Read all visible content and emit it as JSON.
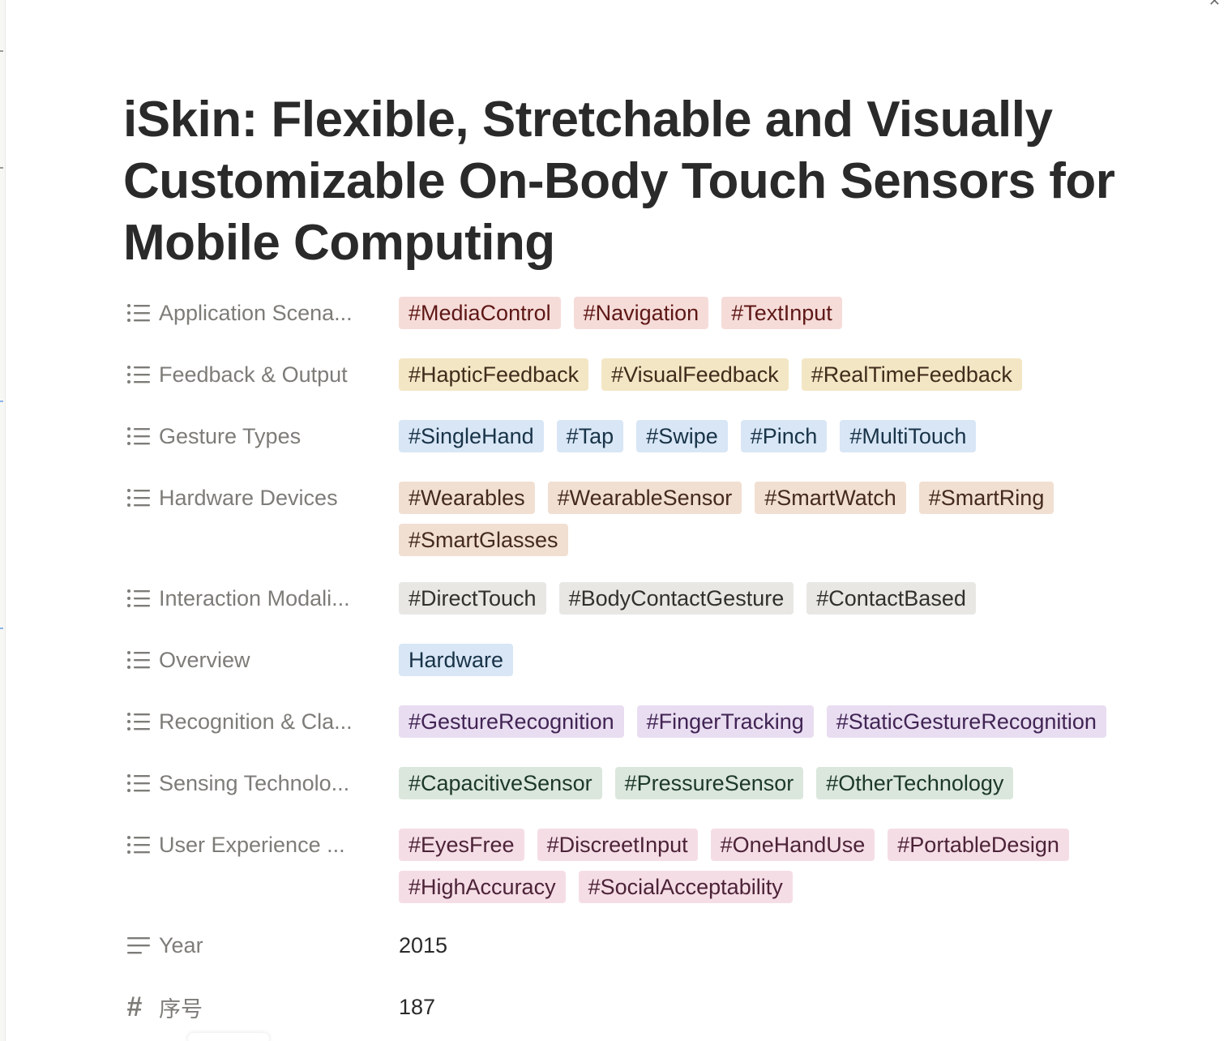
{
  "page": {
    "title": "iSkin: Flexible, Stretchable and Visually Customizable On-Body Touch Sensors for Mobile Computing"
  },
  "colors": {
    "red": "#f6dcd9",
    "yellow": "#f3e6c4",
    "blue": "#d8e6f6",
    "brown": "#f1dfd2",
    "gray": "#e8e7e4",
    "purple": "#e9ddf1",
    "green": "#dbe7dc",
    "pink": "#f5dde6"
  },
  "properties": [
    {
      "icon": "list-icon",
      "label": "Application Scena...",
      "color": "red",
      "tags": [
        "#MediaControl",
        "#Navigation",
        "#TextInput"
      ]
    },
    {
      "icon": "list-icon",
      "label": "Feedback & Output",
      "color": "yellow",
      "tags": [
        "#HapticFeedback",
        "#VisualFeedback",
        "#RealTimeFeedback"
      ]
    },
    {
      "icon": "list-icon",
      "label": "Gesture Types",
      "color": "blue",
      "tags": [
        "#SingleHand",
        "#Tap",
        "#Swipe",
        "#Pinch",
        "#MultiTouch"
      ]
    },
    {
      "icon": "list-icon",
      "label": "Hardware Devices",
      "color": "brown",
      "tags": [
        "#Wearables",
        "#WearableSensor",
        "#SmartWatch",
        "#SmartRing",
        "#SmartGlasses"
      ]
    },
    {
      "icon": "list-icon",
      "label": "Interaction Modali...",
      "color": "gray",
      "tags": [
        "#DirectTouch",
        "#BodyContactGesture",
        "#ContactBased"
      ]
    },
    {
      "icon": "list-icon",
      "label": "Overview",
      "color": "blue",
      "tags": [
        "Hardware"
      ]
    },
    {
      "icon": "list-icon",
      "label": "Recognition & Cla...",
      "color": "purple",
      "tags": [
        "#GestureRecognition",
        "#FingerTracking",
        "#StaticGestureRecognition"
      ]
    },
    {
      "icon": "list-icon",
      "label": "Sensing Technolo...",
      "color": "green",
      "tags": [
        "#CapacitiveSensor",
        "#PressureSensor",
        "#OtherTechnology"
      ]
    },
    {
      "icon": "list-icon",
      "label": "User Experience ...",
      "color": "pink",
      "tags": [
        "#EyesFree",
        "#DiscreetInput",
        "#OneHandUse",
        "#PortableDesign",
        "#HighAccuracy",
        "#SocialAcceptability"
      ]
    }
  ],
  "plain_properties": [
    {
      "icon": "text-lines-icon",
      "label": "Year",
      "value": "2015"
    },
    {
      "icon": "number-hash-icon",
      "label": "序号",
      "value": "187"
    }
  ]
}
